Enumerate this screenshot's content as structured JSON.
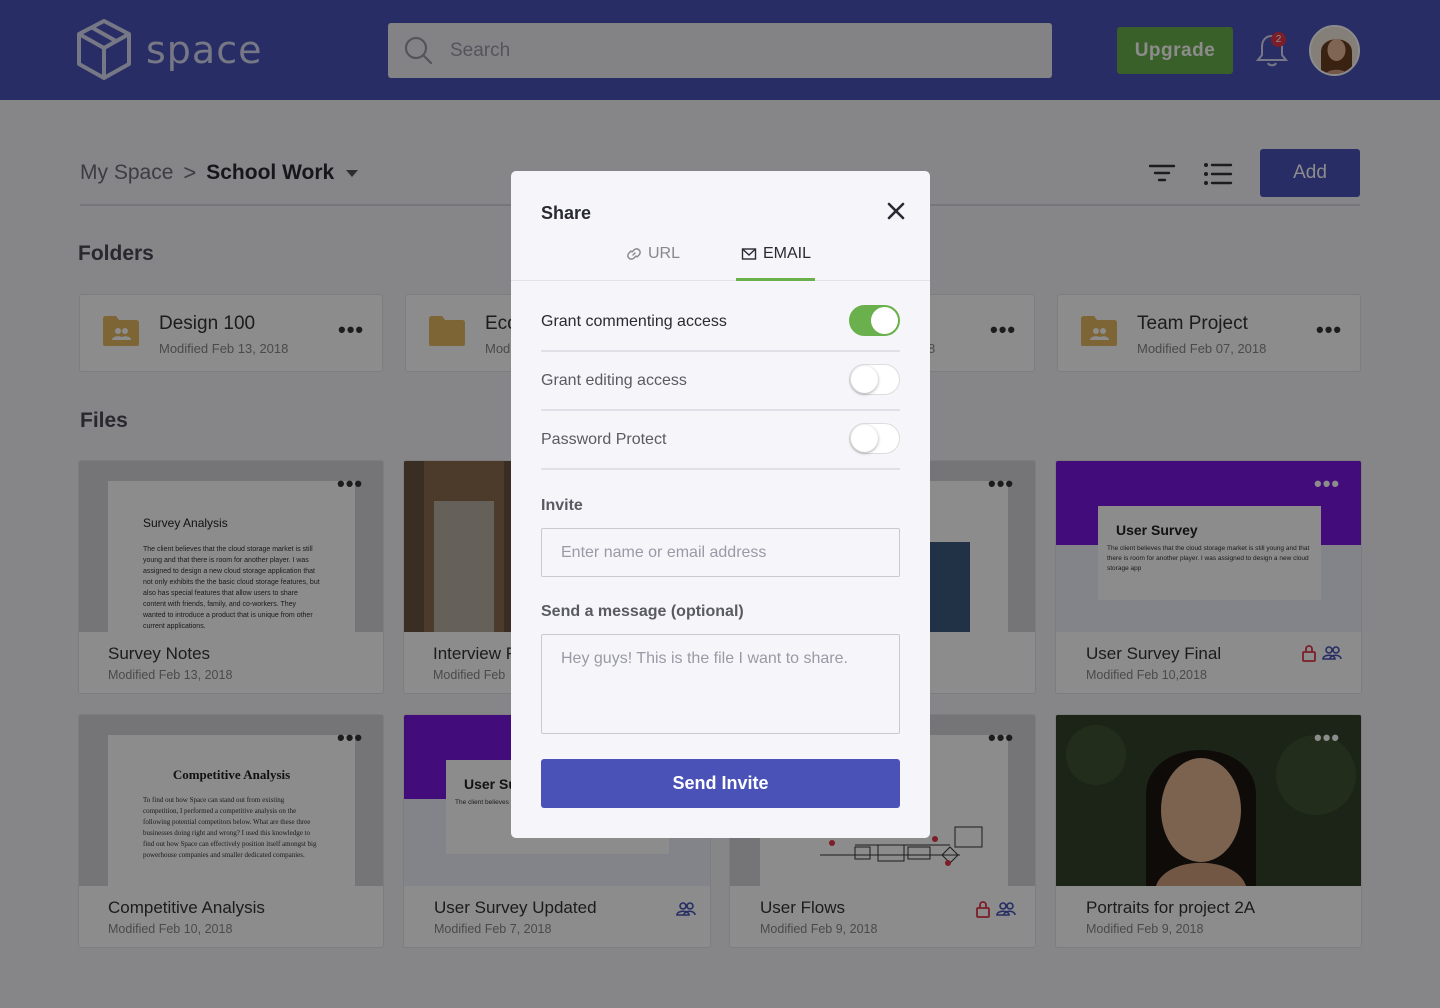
{
  "app": {
    "name": "space"
  },
  "header": {
    "search_placeholder": "Search",
    "upgrade_label": "Upgrade",
    "notification_count": "2"
  },
  "breadcrumb": {
    "root": "My Space",
    "separator": ">",
    "current": "School Work"
  },
  "toolbar": {
    "add_label": "Add"
  },
  "sections": {
    "folders": "Folders",
    "files": "Files"
  },
  "folders": [
    {
      "name": "Design 100",
      "date": "Modified Feb 13, 2018"
    },
    {
      "name": "Eco",
      "date": "Mod"
    },
    {
      "name": "",
      "date": "8"
    },
    {
      "name": "Team Project",
      "date": "Modified Feb 07, 2018"
    }
  ],
  "files": [
    {
      "name": "Survey Notes",
      "date": "Modified Feb 13, 2018",
      "doc_title": "Survey Analysis",
      "doc_body": "The client believes that the cloud storage market is still young and that there is room for another player. I was assigned to design a new cloud storage application that not only exhibits the the basic cloud storage features, but also has special features that allow users to share content with friends, family, and co-workers. They wanted to introduce a product that is unique from other current applications."
    },
    {
      "name": "Interview F",
      "date": "Modified Feb"
    },
    {
      "name": "",
      "date": ""
    },
    {
      "name": "User Survey Final",
      "date": "Modified Feb 10,2018",
      "doc_title": "User Survey",
      "doc_body": "The client believes that the cloud storage market is still young and that there is room for another player. I was assigned to design a new cloud storage app"
    },
    {
      "name": "Competitive Analysis",
      "date": "Modified Feb 10, 2018",
      "doc_title": "Competitive Analysis",
      "doc_body": "To find out how Space can stand out from existing competition, I performed a competitive analysis on the following potential competitors below. What are these three businesses doing right and wrong? I used this knowledge to find out how Space can effectively position itself amongst big powerhouse companies and smaller dedicated companies."
    },
    {
      "name": "User Survey Updated",
      "date": "Modified Feb 7, 2018",
      "doc_title": "User Su",
      "doc_body": "The client believes that there is room f new cloud storage"
    },
    {
      "name": "User Flows",
      "date": "Modified Feb 9, 2018"
    },
    {
      "name": "Portraits for project 2A",
      "date": "Modified Feb 9, 2018"
    }
  ],
  "modal": {
    "title": "Share",
    "tabs": [
      {
        "label": "URL",
        "icon": "link-icon"
      },
      {
        "label": "EMAIL",
        "icon": "mail-icon"
      }
    ],
    "active_tab": "EMAIL",
    "options": [
      {
        "label": "Grant commenting access",
        "on": true
      },
      {
        "label": "Grant editing access",
        "on": false
      },
      {
        "label": "Password Protect",
        "on": false
      }
    ],
    "invite_label": "Invite",
    "invite_placeholder": "Enter name or email address",
    "message_label": "Send a message (optional)",
    "message_placeholder": "Hey guys! This is the file I want to share.",
    "send_label": "Send Invite"
  },
  "colors": {
    "brand": "#4a52b8",
    "accent_green": "#6ab04c",
    "purple": "#7b16e0",
    "lock_red": "#e0374b"
  }
}
